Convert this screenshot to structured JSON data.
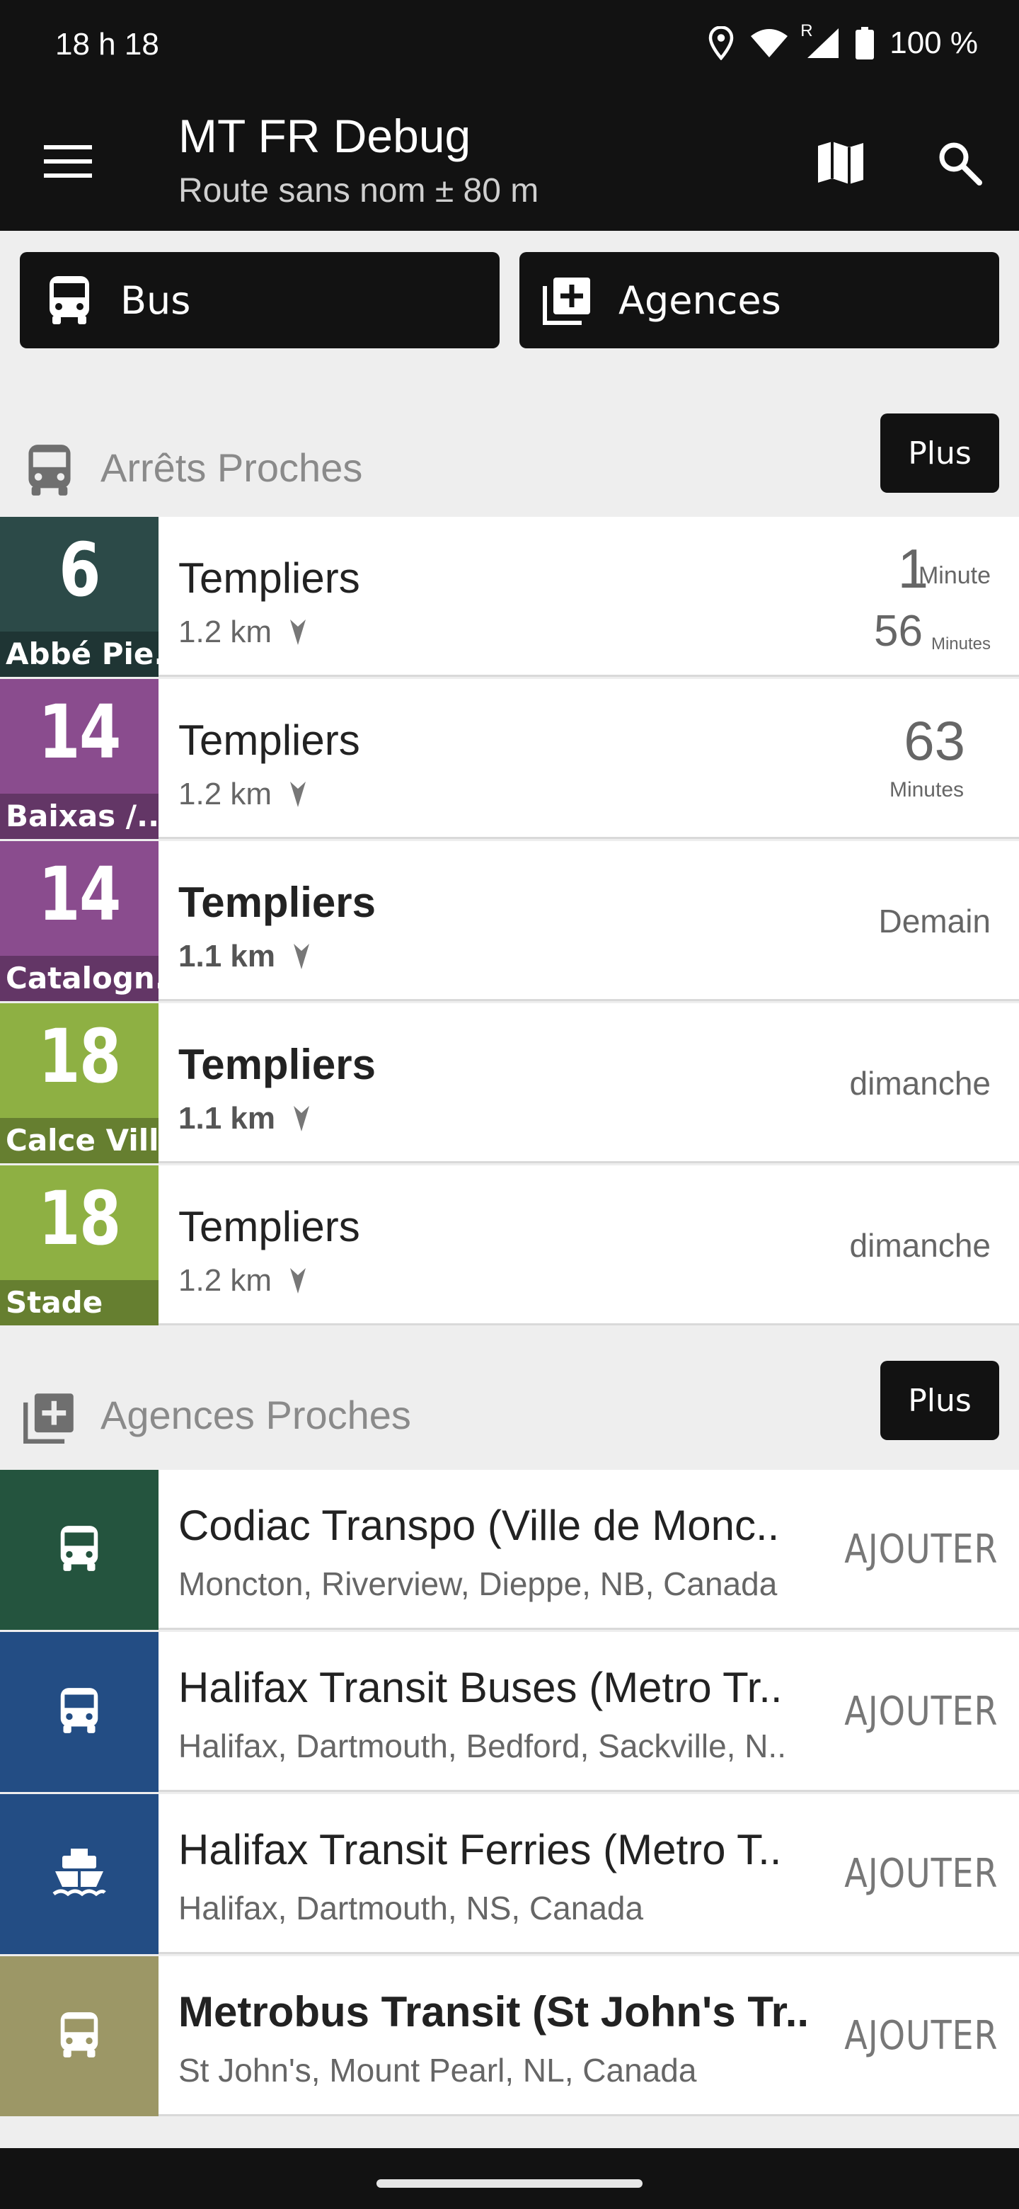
{
  "status_bar": {
    "time": "18 h 18",
    "roaming": "R",
    "battery": "100 %"
  },
  "app_bar": {
    "title": "MT FR Debug",
    "subtitle": "Route sans nom ± 80 m"
  },
  "top_buttons": {
    "bus_label": "Bus",
    "agencies_label": "Agences"
  },
  "nearby_stops": {
    "title": "Arrêts Proches",
    "more_label": "Plus",
    "rows": [
      {
        "route": "6",
        "direction": "Abbé Pie..",
        "color": "#2c4a48",
        "stop": "Templiers",
        "distance": "1.2 km",
        "bold": false,
        "time1": "1",
        "unit1": "Minute",
        "time2": "56",
        "unit2": "Minutes"
      },
      {
        "route": "14",
        "direction": "Baixas /..",
        "color": "#8a4c8e",
        "stop": "Templiers",
        "distance": "1.2 km",
        "bold": false,
        "time": "63",
        "unit": "Minutes"
      },
      {
        "route": "14",
        "direction": "Catalogn..",
        "color": "#8a4c8e",
        "stop": "Templiers",
        "distance": "1.1 km",
        "bold": true,
        "word": "Demain"
      },
      {
        "route": "18",
        "direction": "Calce Vill..",
        "color": "#8eb043",
        "stop": "Templiers",
        "distance": "1.1 km",
        "bold": true,
        "word": "dimanche"
      },
      {
        "route": "18",
        "direction": "Stade",
        "color": "#8eb043",
        "stop": "Templiers",
        "distance": "1.2 km",
        "bold": false,
        "word": "dimanche"
      }
    ]
  },
  "nearby_agencies": {
    "title": "Agences Proches",
    "more_label": "Plus",
    "add_label": "AJOUTER",
    "rows": [
      {
        "name": "Codiac Transpo (Ville de Monc..",
        "location": "Moncton, Riverview, Dieppe, NB, Canada",
        "color": "#24543e",
        "icon": "bus-icon",
        "bold": false
      },
      {
        "name": "Halifax Transit Buses (Metro Tr..",
        "location": "Halifax, Dartmouth, Bedford, Sackville, N..",
        "color": "#234d84",
        "icon": "bus-icon",
        "bold": false
      },
      {
        "name": "Halifax Transit Ferries (Metro T..",
        "location": "Halifax, Dartmouth, NS, Canada",
        "color": "#234d84",
        "icon": "ferry-icon",
        "bold": false
      },
      {
        "name": "Metrobus Transit (St John's Tr..",
        "location": "St John's, Mount Pearl, NL, Canada",
        "color": "#9c9766",
        "icon": "bus-icon",
        "bold": true
      }
    ]
  }
}
